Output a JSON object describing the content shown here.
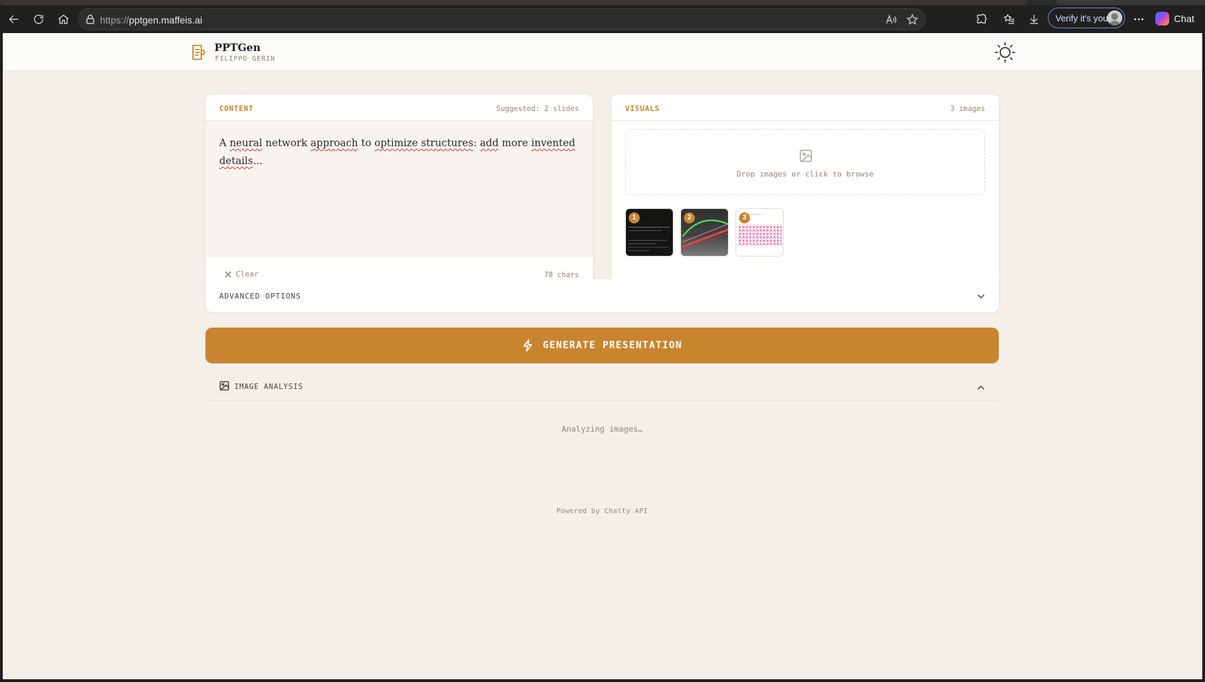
{
  "browser": {
    "url_protocol": "https://",
    "url_host": "pptgen.maffeis.ai",
    "verify_label": "Verify it's you",
    "chat_label": "Chat"
  },
  "app": {
    "title": "PPTGen",
    "subtitle": "FILIPPO GERIN"
  },
  "content": {
    "label": "CONTENT",
    "suggestion": "Suggested: 2 slides",
    "text_segments": [
      {
        "t": "A ",
        "sq": false
      },
      {
        "t": "neural",
        "sq": true
      },
      {
        "t": " network ",
        "sq": false
      },
      {
        "t": "approach",
        "sq": true
      },
      {
        "t": " to ",
        "sq": false
      },
      {
        "t": "optimize structures",
        "sq": true
      },
      {
        "t": ": ",
        "sq": false
      },
      {
        "t": "add",
        "sq": true
      },
      {
        "t": " more ",
        "sq": false
      },
      {
        "t": "invented",
        "sq": true
      },
      {
        "t": " ",
        "sq": false
      },
      {
        "t": "details",
        "sq": true
      },
      {
        "t": "...",
        "sq": false
      }
    ],
    "clear_label": "Clear",
    "char_count": "78 chars"
  },
  "visuals": {
    "label": "VISUALS",
    "count": "3 images",
    "dropzone_text": "Drop images or click to browse",
    "thumbnails": [
      {
        "number": "1"
      },
      {
        "number": "2"
      },
      {
        "number": "3"
      }
    ]
  },
  "advanced": {
    "label": "ADVANCED OPTIONS"
  },
  "generate": {
    "label": "GENERATE PRESENTATION"
  },
  "image_analysis": {
    "label": "IMAGE ANALYSIS",
    "status": "Analyzing images…"
  },
  "footer": {
    "text": "Powered by Chatty API"
  },
  "colors": {
    "accent": "#c98430",
    "page_bg": "#f4efe8",
    "card_bg": "#ffffff"
  }
}
